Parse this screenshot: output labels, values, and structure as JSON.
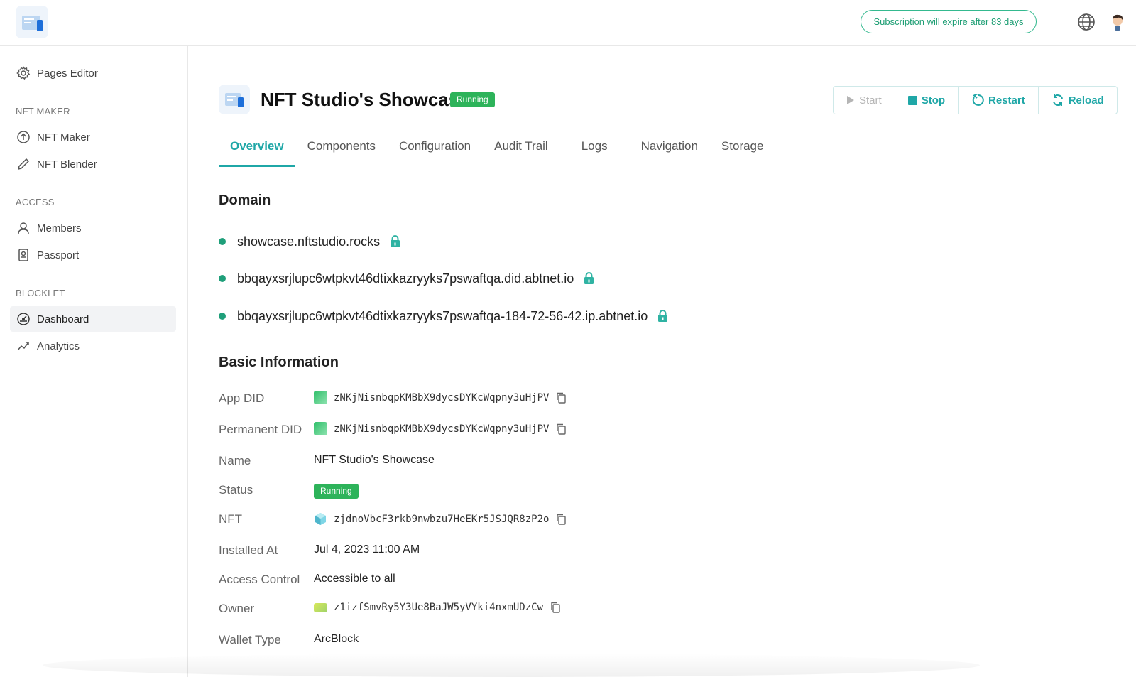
{
  "header": {
    "subscription_text": "Subscription will expire after 83 days"
  },
  "sidebar": {
    "items": [
      {
        "label": "Pages Editor",
        "icon": "gear-icon"
      },
      {
        "label": "NFT Maker",
        "icon": "arrow-up-circle-icon"
      },
      {
        "label": "NFT Blender",
        "icon": "pencil-icon"
      },
      {
        "label": "Members",
        "icon": "user-icon"
      },
      {
        "label": "Passport",
        "icon": "passport-icon"
      },
      {
        "label": "Dashboard",
        "icon": "dashboard-gauge-icon",
        "active": true
      },
      {
        "label": "Analytics",
        "icon": "analytics-icon"
      }
    ],
    "sections": [
      "NFT MAKER",
      "ACCESS",
      "BLOCKLET"
    ]
  },
  "app": {
    "title": "NFT Studio's Showcase",
    "status": "Running"
  },
  "actions": {
    "start": "Start",
    "stop": "Stop",
    "restart": "Restart",
    "reload": "Reload"
  },
  "tabs": [
    "Overview",
    "Components",
    "Configuration",
    "Audit Trail",
    "Logs",
    "Navigation",
    "Storage"
  ],
  "domain": {
    "title": "Domain",
    "items": [
      "showcase.nftstudio.rocks",
      "bbqayxsrjlupc6wtpkvt46dtixkazryyks7pswaftqa.did.abtnet.io",
      "bbqayxsrjlupc6wtpkvt46dtixkazryyks7pswaftqa-184-72-56-42.ip.abtnet.io"
    ]
  },
  "basic": {
    "title": "Basic Information",
    "labels": {
      "app_did": "App DID",
      "permanent_did": "Permanent DID",
      "name": "Name",
      "status": "Status",
      "nft": "NFT",
      "installed_at": "Installed At",
      "access_control": "Access Control",
      "owner": "Owner",
      "wallet_type": "Wallet Type"
    },
    "values": {
      "app_did": "zNKjNisnbqpKMBbX9dycsDYKcWqpny3uHjPV",
      "permanent_did": "zNKjNisnbqpKMBbX9dycsDYKcWqpny3uHjPV",
      "name": "NFT Studio's Showcase",
      "status": "Running",
      "nft": "zjdnoVbcF3rkb9nwbzu7HeEKr5JSJQR8zP2o",
      "installed_at": "Jul 4, 2023 11:00 AM",
      "access_control": "Accessible to all",
      "owner": "z1izfSmvRy5Y3Ue8BaJW5yVYki4nxmUDzCw",
      "wallet_type": "ArcBlock"
    }
  },
  "colors": {
    "accent": "#1fa7a7",
    "running": "#2db35a",
    "domain_dot": "#1f9f7a"
  }
}
